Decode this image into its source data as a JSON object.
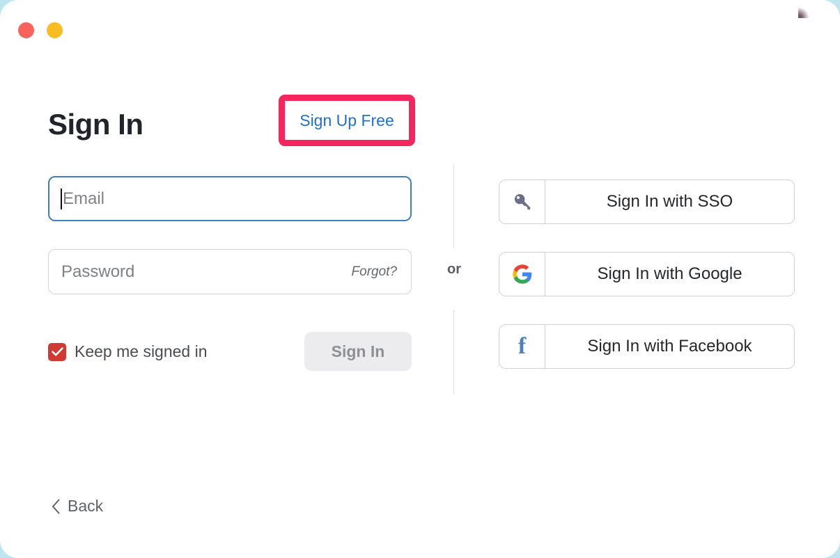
{
  "window": {
    "traffic_lights": [
      {
        "name": "close",
        "color": "#f9635b"
      },
      {
        "name": "minimize",
        "color": "#f7bd22"
      }
    ],
    "background_color": "#bfe6f0",
    "surface_color": "#ffffff"
  },
  "header": {
    "title": "Sign In",
    "signup_label": "Sign Up Free",
    "signup_link_color": "#1d6fd4",
    "highlight_color": "#f5255e"
  },
  "form": {
    "email": {
      "placeholder": "Email",
      "value": "",
      "focused": true,
      "focus_border_color": "#3f7fc1"
    },
    "password": {
      "placeholder": "Password",
      "value": "",
      "forgot_label": "Forgot?"
    },
    "keep_signed_in": {
      "label": "Keep me signed in",
      "checked": true,
      "check_color": "#d03a32"
    },
    "submit": {
      "label": "Sign In",
      "enabled": false,
      "background": "#ececef",
      "text_color": "#8e9096"
    }
  },
  "divider": {
    "label": "or"
  },
  "sso": {
    "buttons": [
      {
        "label": "Sign In with SSO",
        "icon": "key-icon"
      },
      {
        "label": "Sign In with Google",
        "icon": "google-g-icon"
      },
      {
        "label": "Sign In with Facebook",
        "icon": "facebook-f-icon",
        "glyph": "f"
      }
    ]
  },
  "footer": {
    "back_label": "Back"
  }
}
